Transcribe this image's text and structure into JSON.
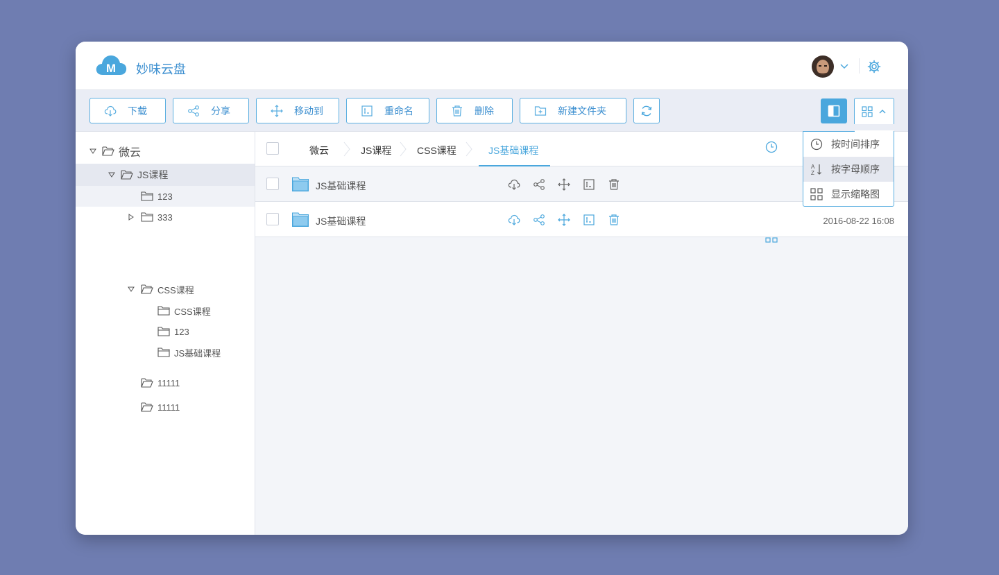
{
  "app": {
    "name": "妙味云盘",
    "logo_letter": "M"
  },
  "header": {
    "user_avatar": "user-avatar",
    "settings_icon": "gear-icon"
  },
  "toolbar": {
    "buttons": [
      {
        "label": "下载",
        "icon": "cloud-download-icon"
      },
      {
        "label": "分享",
        "icon": "share-icon"
      },
      {
        "label": "移动到",
        "icon": "move-icon"
      },
      {
        "label": "重命名",
        "icon": "rename-icon"
      },
      {
        "label": "删除",
        "icon": "trash-icon"
      },
      {
        "label": "新建文件夹",
        "icon": "new-folder-icon"
      }
    ]
  },
  "sidebar": {
    "tree": [
      {
        "label": "微云",
        "expanded": true
      },
      {
        "label": "JS课程",
        "expanded": true,
        "selected": true
      },
      {
        "label": "123"
      },
      {
        "label": "333",
        "expanded": false
      },
      {
        "label": "CSS课程",
        "expanded": true
      },
      {
        "label": "CSS课程"
      },
      {
        "label": "123"
      },
      {
        "label": "JS基础课程"
      },
      {
        "label": "11111"
      },
      {
        "label": "11111"
      }
    ]
  },
  "breadcrumb": [
    "微云",
    "JS课程",
    "CSS课程",
    "JS基础课程"
  ],
  "files": [
    {
      "name": "JS基础课程",
      "date": ""
    },
    {
      "name": "JS基础课程",
      "date": "2016-08-22   16:08"
    }
  ],
  "view_menu": {
    "items": [
      {
        "label": "按时间排序",
        "icon": "clock-icon"
      },
      {
        "label": "按字母顺序",
        "icon": "sort-alpha-icon",
        "highlighted": true
      },
      {
        "label": "显示缩略图",
        "icon": "grid-icon"
      }
    ]
  },
  "colors": {
    "accent": "#4aa7dd",
    "background": "#6f7db1"
  }
}
